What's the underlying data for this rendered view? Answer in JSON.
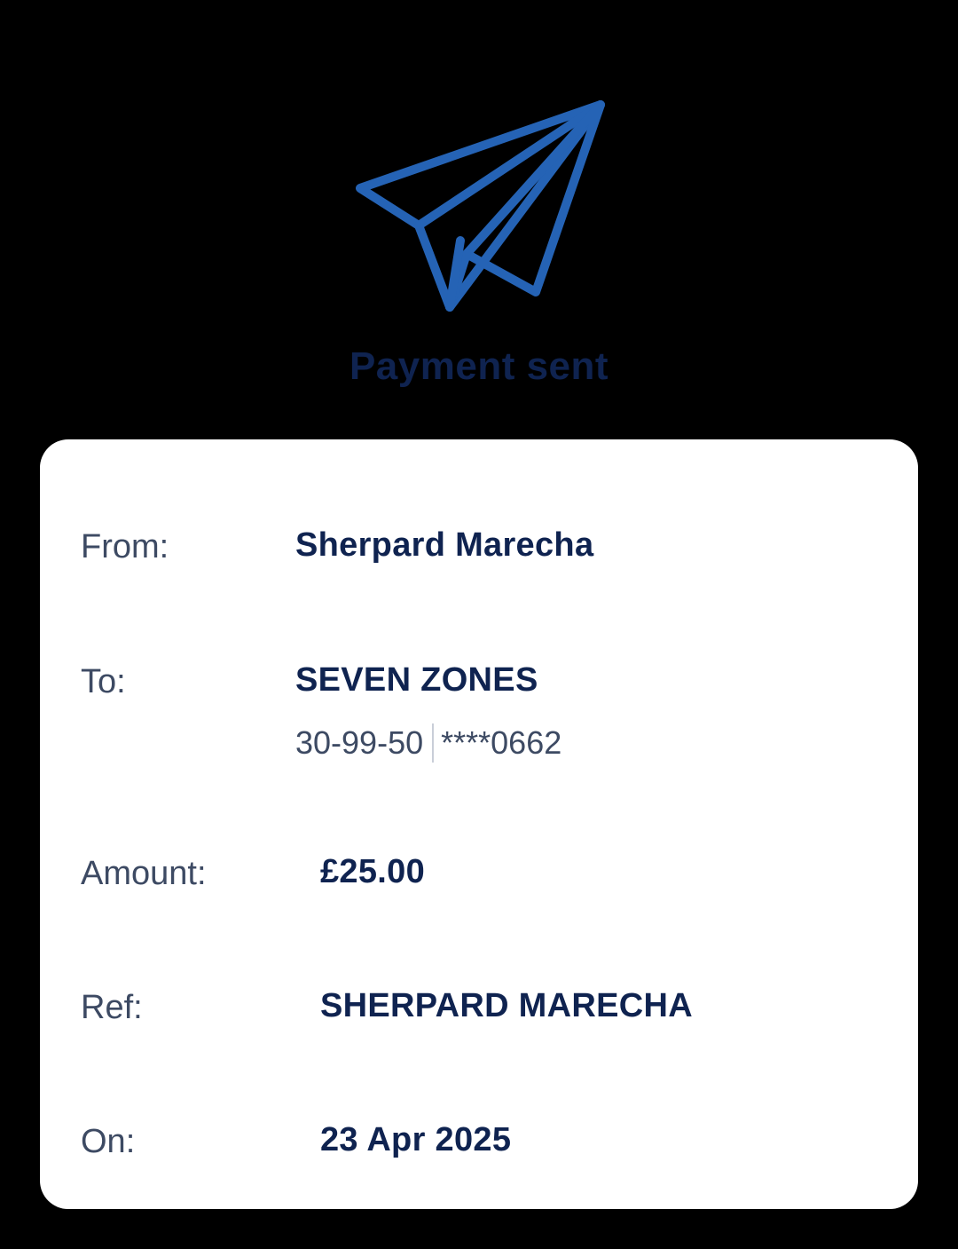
{
  "header": {
    "icon": "paper-plane-icon",
    "title": "Payment sent"
  },
  "colors": {
    "icon_blue": "#2563b5",
    "title_navy": "#0f2350",
    "label_gray": "#3d4a63",
    "card_bg": "#ffffff",
    "page_bg": "#000000"
  },
  "details": {
    "from_label": "From:",
    "from_value": "Sherpard Marecha",
    "to_label": "To:",
    "to_value": "SEVEN ZONES",
    "to_sort_code": "30-99-50",
    "to_account": "****0662",
    "amount_label": "Amount:",
    "amount_value": "£25.00",
    "ref_label": "Ref:",
    "ref_value": "SHERPARD MARECHA",
    "on_label": "On:",
    "on_value": "23 Apr 2025"
  }
}
